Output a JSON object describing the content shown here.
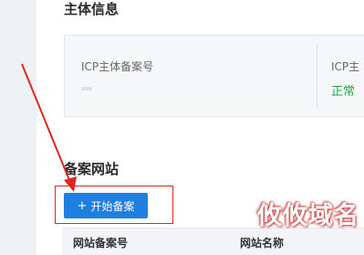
{
  "subject_info": {
    "title": "主体信息",
    "icp_subject_label": "ICP主体备案号",
    "icp_subject_label_2": "ICP主",
    "status": "正常"
  },
  "filing_sites": {
    "title": "备案网站",
    "start_button_label": "开始备案",
    "table_headers": [
      "网站备案号",
      "网站名称"
    ]
  },
  "watermark": "攸攸域名",
  "colors": {
    "accent": "#1f7fe0",
    "status_ok": "#21a74a",
    "annotation": "#e0261f"
  },
  "icons": {
    "start_button": "plus-icon"
  }
}
